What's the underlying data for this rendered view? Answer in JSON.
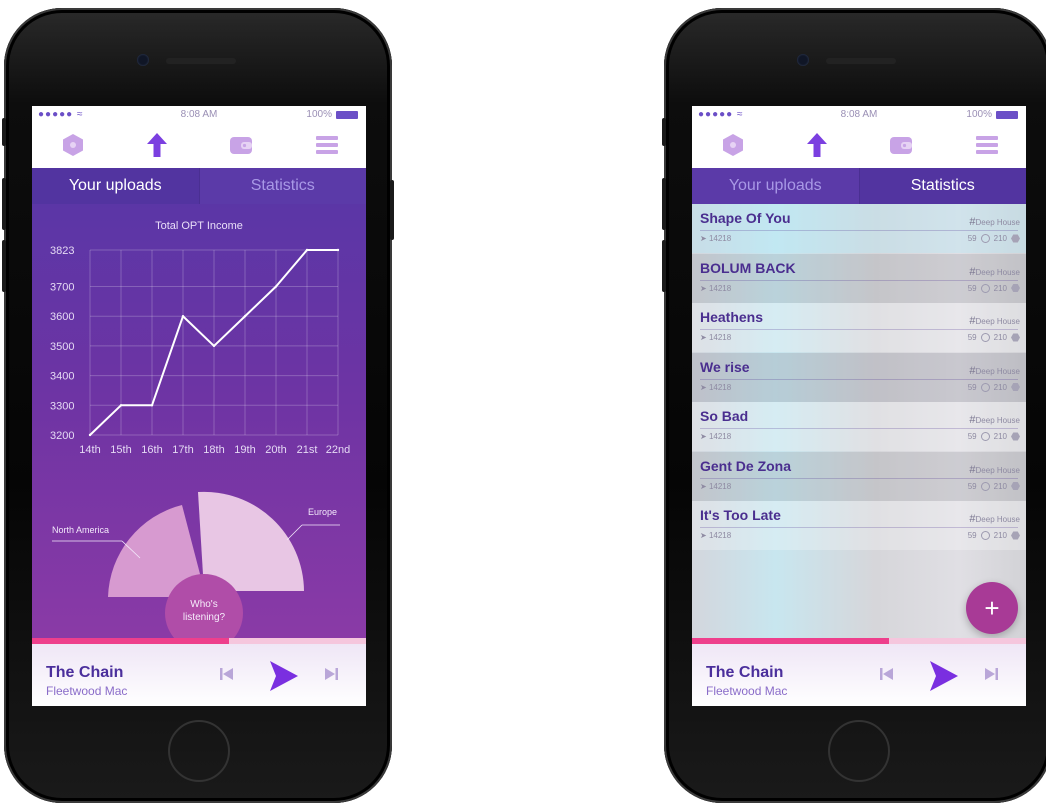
{
  "status_bar": {
    "signal": "●●●●● ≈",
    "time": "8:08 AM",
    "battery": "100%"
  },
  "icons": [
    "hexagon-icon",
    "upload-arrow-icon",
    "wallet-icon",
    "menu-icon"
  ],
  "tabs": {
    "uploads": "Your uploads",
    "statistics": "Statistics"
  },
  "colors": {
    "accent": "#6b4fc7",
    "tab_bar": "#5b3aa8",
    "progress": "#ee3f8c",
    "fab": "#a83a96"
  },
  "chart_data": [
    {
      "type": "line",
      "title": "Total OPT Income",
      "x": [
        "14th",
        "15th",
        "16th",
        "17th",
        "18th",
        "19th",
        "20th",
        "21st",
        "22nd"
      ],
      "values": [
        3200,
        3300,
        3300,
        3600,
        3500,
        3600,
        3700,
        3823,
        3823
      ],
      "ylim": [
        3200,
        3823
      ],
      "yticks": [
        "3823",
        "3700",
        "3600",
        "3500",
        "3400",
        "3300",
        "3200"
      ],
      "grid": true
    },
    {
      "type": "pie",
      "title": "Who's listening?",
      "slices": [
        {
          "label": "North America",
          "value": 45
        },
        {
          "label": "Europe",
          "value": 55
        }
      ]
    }
  ],
  "pie": {
    "center_line1": "Who's",
    "center_line2": "listening?",
    "label_na": "North America",
    "label_eu": "Europe"
  },
  "uploads": [
    {
      "title": "Shape Of You",
      "genre": "Deep House",
      "plays": "14218",
      "coins": "59",
      "hex": "210"
    },
    {
      "title": "BOLUM BACK",
      "genre": "Deep House",
      "plays": "14218",
      "coins": "59",
      "hex": "210"
    },
    {
      "title": "Heathens",
      "genre": "Deep House",
      "plays": "14218",
      "coins": "59",
      "hex": "210"
    },
    {
      "title": "We rise",
      "genre": "Deep House",
      "plays": "14218",
      "coins": "59",
      "hex": "210"
    },
    {
      "title": "So Bad",
      "genre": "Deep House",
      "plays": "14218",
      "coins": "59",
      "hex": "210"
    },
    {
      "title": "Gent De Zona",
      "genre": "Deep House",
      "plays": "14218",
      "coins": "59",
      "hex": "210"
    },
    {
      "title": "It's Too Late",
      "genre": "Deep House",
      "plays": "14218",
      "coins": "59",
      "hex": "210"
    }
  ],
  "fab_label": "+",
  "player": {
    "title": "The Chain",
    "artist": "Fleetwood Mac",
    "progress_left": 0.59,
    "progress_right": 0.59
  }
}
